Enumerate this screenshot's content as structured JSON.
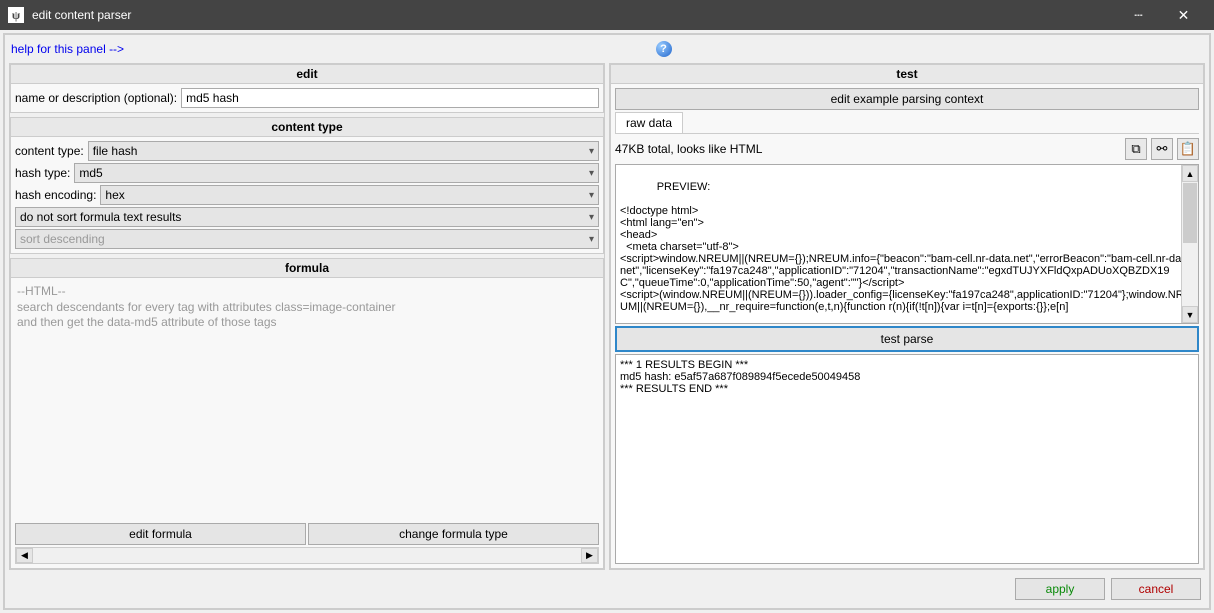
{
  "window": {
    "title": "edit content parser"
  },
  "helpbar": {
    "link": "help for this panel -->"
  },
  "edit": {
    "head": "edit",
    "name_label": "name or description (optional):",
    "name_value": "md5 hash",
    "content_type_head": "content type",
    "content_type_label": "content type:",
    "content_type_value": "file hash",
    "hash_type_label": "hash type:",
    "hash_type_value": "md5",
    "hash_encoding_label": "hash encoding:",
    "hash_encoding_value": "hex",
    "sort1": "do not sort formula text results",
    "sort2": "sort descending"
  },
  "formula": {
    "head": "formula",
    "desc": "--HTML--\nsearch descendants for every tag with attributes class=image-container\nand then get the data-md5 attribute of those tags",
    "edit_btn": "edit formula",
    "change_btn": "change formula type"
  },
  "test": {
    "head": "test",
    "context_btn": "edit example parsing context",
    "tab": "raw data",
    "status": "47KB total, looks like HTML",
    "preview": "PREVIEW:\n\n<!doctype html>\n<html lang=\"en\">\n<head>\n  <meta charset=\"utf-8\">\n<script>window.NREUM||(NREUM={});NREUM.info={\"beacon\":\"bam-cell.nr-data.net\",\"errorBeacon\":\"bam-cell.nr-data.net\",\"licenseKey\":\"fa197ca248\",\"applicationID\":\"71204\",\"transactionName\":\"egxdTUJYXFldQxpADUoXQBZDX19C\",\"queueTime\":0,\"applicationTime\":50,\"agent\":\"\"}</script>\n<script>(window.NREUM||(NREUM={})).loader_config={licenseKey:\"fa197ca248\",applicationID:\"71204\"};window.NREUM||(NREUM={}),__nr_require=function(e,t,n){function r(n){if(!t[n]){var i=t[n]={exports:{}};e[n]",
    "parse_btn": "test parse",
    "results": "*** 1 RESULTS BEGIN ***\nmd5 hash: e5af57a687f089894f5ecede50049458\n*** RESULTS END ***"
  },
  "bottom": {
    "apply": "apply",
    "cancel": "cancel"
  }
}
